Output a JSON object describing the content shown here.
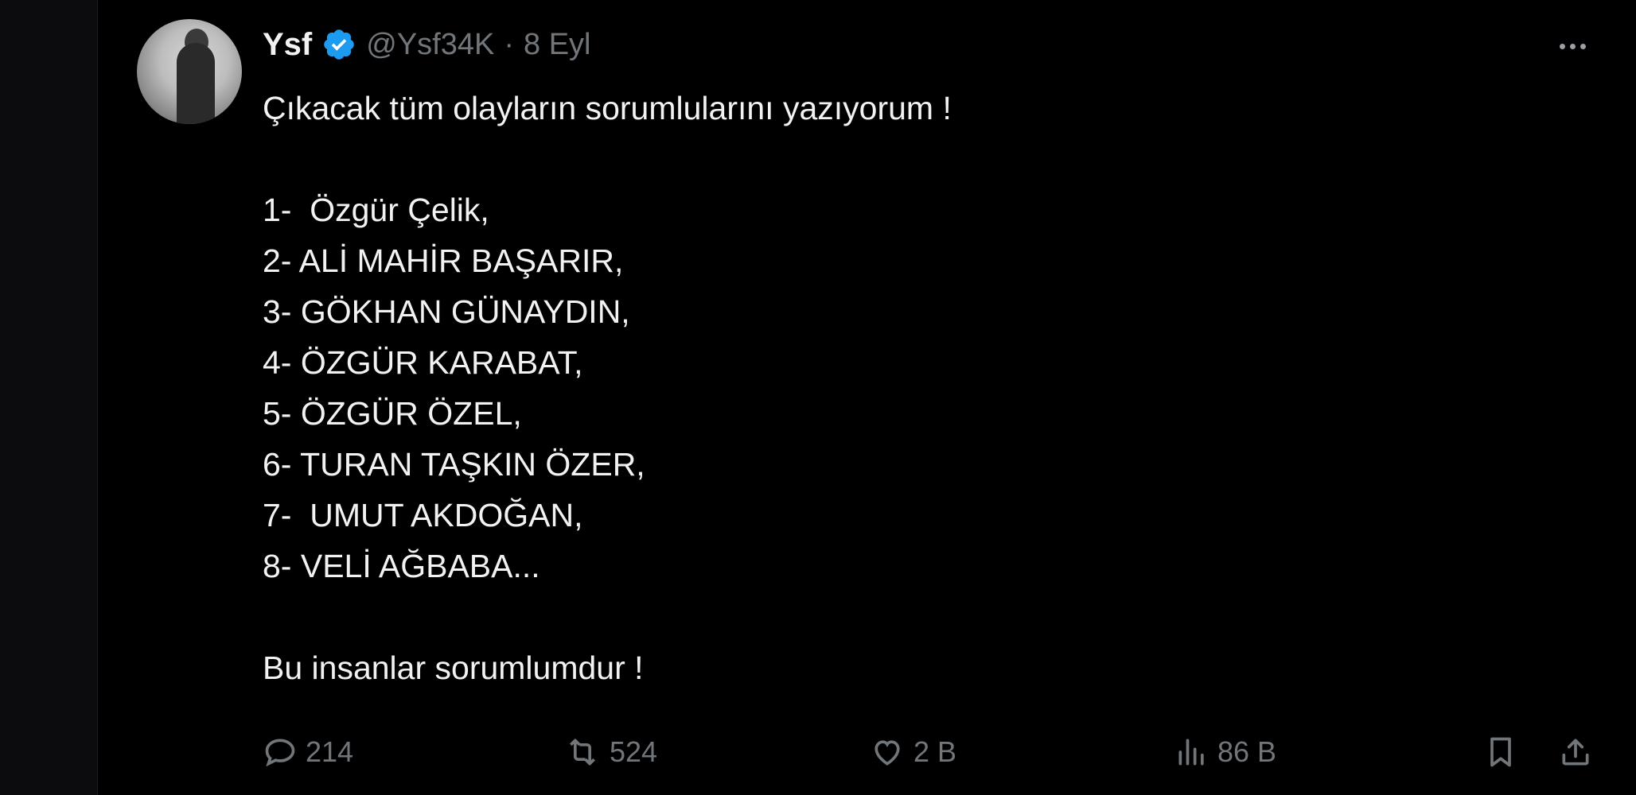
{
  "tweet": {
    "display_name": "Ysf",
    "handle": "@Ysf34K",
    "separator": "·",
    "date": "8 Eyl",
    "lines": [
      "Çıkacak tüm olayların sorumlularını yazıyorum !",
      "",
      "1-  Özgür Çelik,",
      "2- ALİ MAHİR BAŞARIR,",
      "3- GÖKHAN GÜNAYDIN,",
      "4- ÖZGÜR KARABAT,",
      "5- ÖZGÜR ÖZEL,",
      "6- TURAN TAŞKIN ÖZER,",
      "7-  UMUT AKDOĞAN,",
      "8- VELİ AĞBABA...",
      "",
      "Bu insanlar sorumlumdur !"
    ]
  },
  "actions": {
    "reply_count": "214",
    "retweet_count": "524",
    "like_count": "2 B",
    "views_count": "86 B"
  },
  "icons": {
    "verified": "verified-badge-icon",
    "more": "more-icon",
    "reply": "reply-icon",
    "retweet": "retweet-icon",
    "like": "heart-icon",
    "views": "views-icon",
    "bookmark": "bookmark-icon",
    "share": "share-icon"
  },
  "colors": {
    "background": "#000000",
    "text": "#f2f2f2",
    "muted": "#71767b",
    "verified": "#1d9bf0"
  }
}
